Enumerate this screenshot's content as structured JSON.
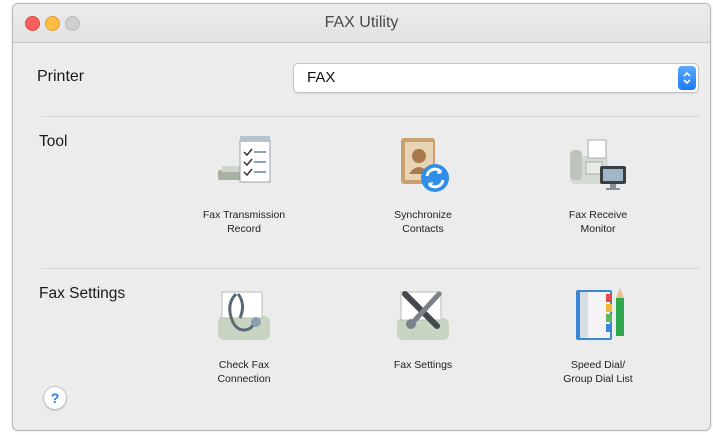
{
  "window": {
    "title": "FAX Utility"
  },
  "printer": {
    "label": "Printer",
    "selected": "FAX"
  },
  "sections": {
    "tool": {
      "label": "Tool",
      "items": [
        {
          "label": "Fax Transmission\nRecord",
          "icon": "transmission-record-icon"
        },
        {
          "label": "Synchronize\nContacts",
          "icon": "sync-contacts-icon"
        },
        {
          "label": "Fax Receive\nMonitor",
          "icon": "receive-monitor-icon"
        }
      ]
    },
    "fax_settings": {
      "label": "Fax Settings",
      "items": [
        {
          "label": "Check Fax\nConnection",
          "icon": "check-connection-icon"
        },
        {
          "label": "Fax Settings",
          "icon": "fax-settings-icon"
        },
        {
          "label": "Speed Dial/\nGroup Dial List",
          "icon": "speed-dial-icon"
        }
      ]
    }
  },
  "help": {
    "label": "?"
  },
  "colors": {
    "accent": "#1b7cf3",
    "window_bg": "#ececec"
  }
}
